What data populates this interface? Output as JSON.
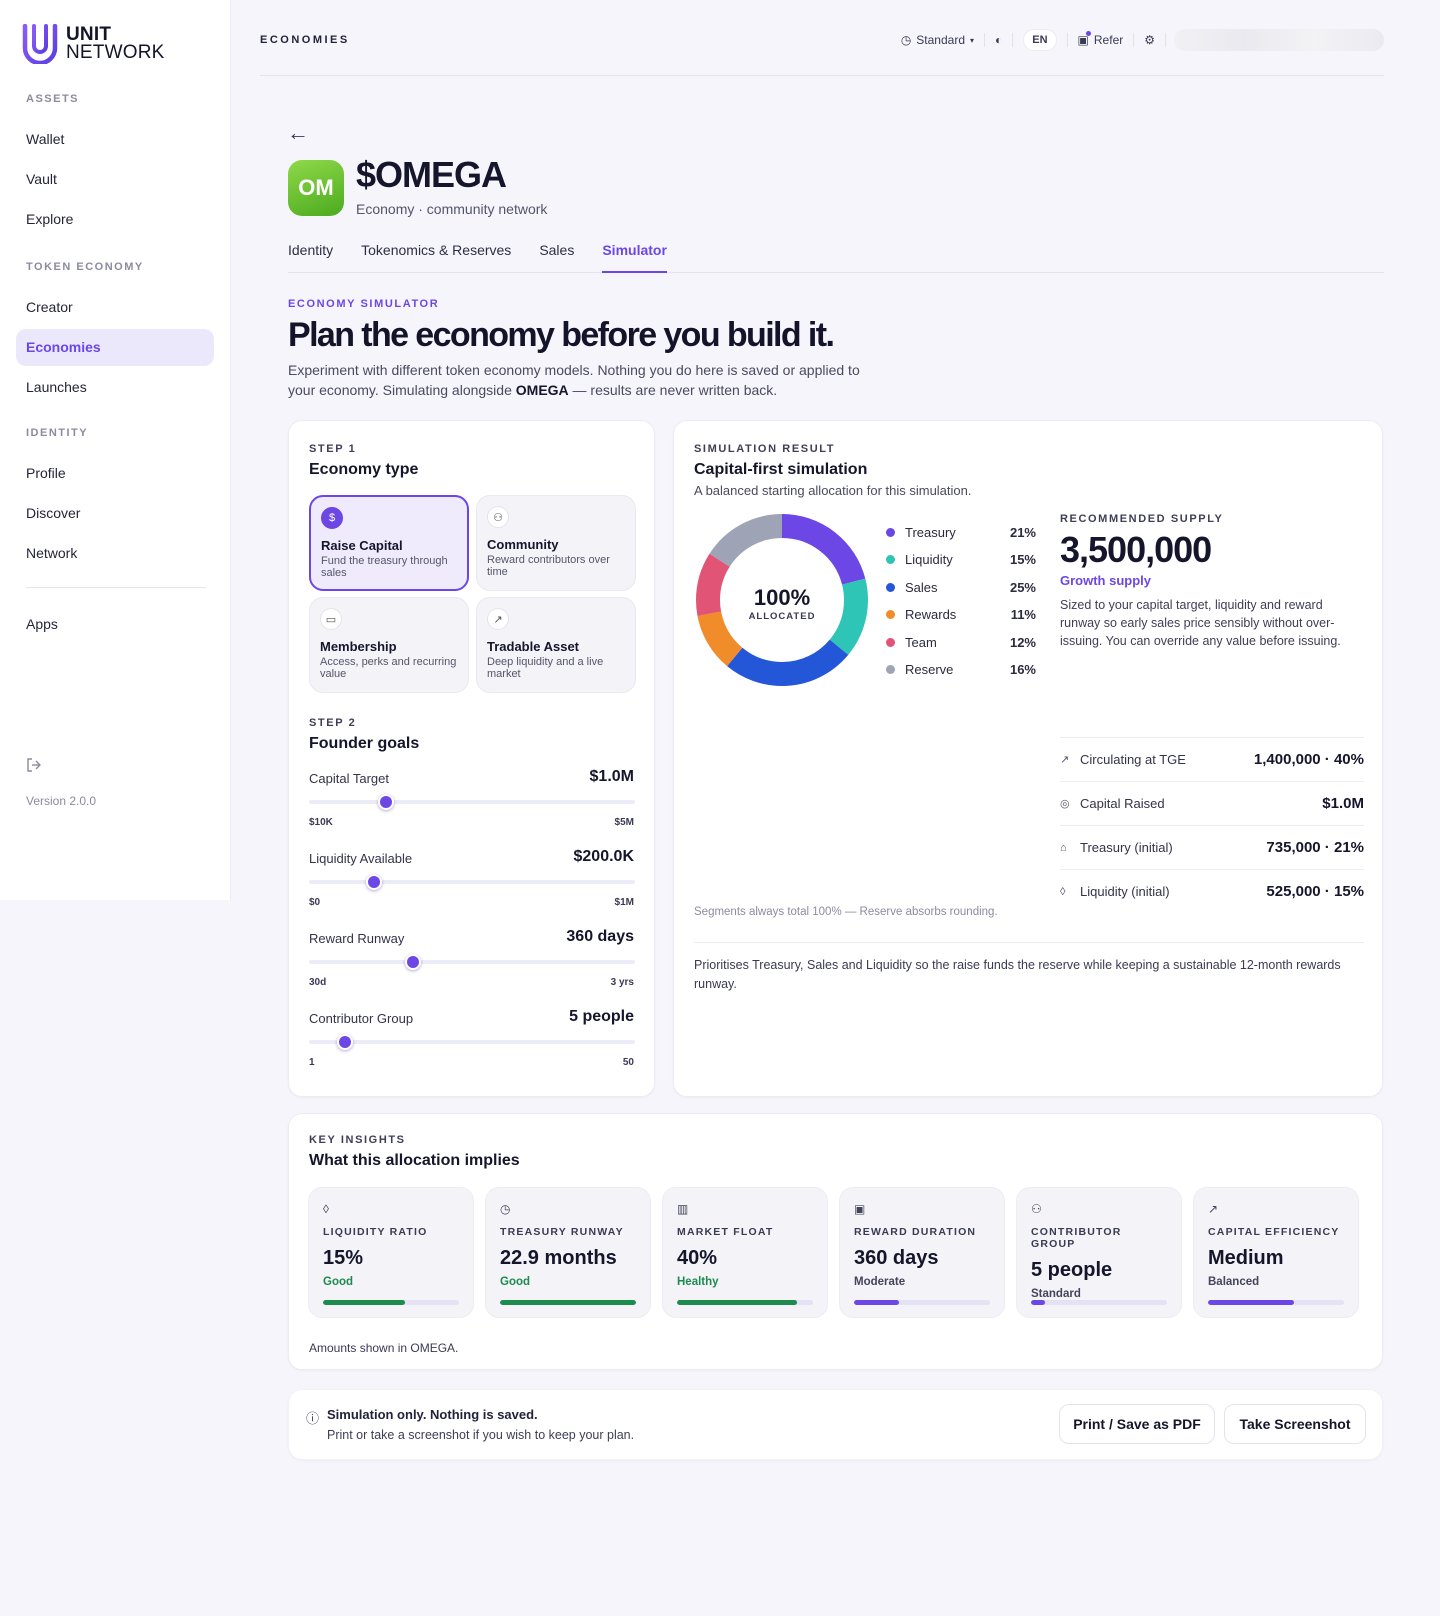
{
  "brand": {
    "line1": "UNIT",
    "line2": "NETWORK",
    "accent": "#6c47e6"
  },
  "sidebar": {
    "sections": [
      {
        "label": "ASSETS",
        "items": [
          "Wallet",
          "Vault",
          "Explore"
        ]
      },
      {
        "label": "TOKEN ECONOMY",
        "items": [
          "Creator",
          "Economies",
          "Launches"
        ]
      },
      {
        "label": "IDENTITY",
        "items": [
          "Profile",
          "Discover",
          "Network"
        ]
      }
    ],
    "active_item": "Economies",
    "apps": "Apps",
    "logout_icon": "logout-icon",
    "version": "Version 2.0.0"
  },
  "topbar": {
    "title": "ECONOMIES",
    "mode": "Standard",
    "lang": "EN",
    "refer": "Refer"
  },
  "page": {
    "back_icon": "arrow-left-icon",
    "avatar": "OM",
    "title": "$OMEGA",
    "subtitle": "Economy · community network",
    "tabs": [
      "Identity",
      "Tokenomics & Reserves",
      "Sales",
      "Simulator"
    ],
    "active_tab": "Simulator",
    "eyebrow": "ECONOMY SIMULATOR",
    "hero": "Plan the economy before you build it.",
    "desc_1": "Experiment with different token economy models. Nothing you do here is saved or applied to your economy. Simulating alongside ",
    "desc_bold": "OMEGA",
    "desc_2": " — results are never written back."
  },
  "step1": {
    "step": "STEP 1",
    "title": "Economy type",
    "types": [
      {
        "name": "Raise Capital",
        "desc": "Fund the treasury through sales",
        "icon": "dollar-icon",
        "glyph": "$",
        "selected": true
      },
      {
        "name": "Community",
        "desc": "Reward contributors over time",
        "icon": "users-icon",
        "glyph": "⚇",
        "selected": false
      },
      {
        "name": "Membership",
        "desc": "Access, perks and recurring value",
        "icon": "card-icon",
        "glyph": "▭",
        "selected": false
      },
      {
        "name": "Tradable Asset",
        "desc": "Deep liquidity and a live market",
        "icon": "trend-up-icon",
        "glyph": "↗",
        "selected": false
      }
    ]
  },
  "step2": {
    "step": "STEP 2",
    "title": "Founder goals",
    "goals": [
      {
        "label": "Capital Target",
        "value": "$1.0M",
        "min": "$10K",
        "max": "$5M",
        "fraction": 0.235
      },
      {
        "label": "Liquidity Available",
        "value": "$200.0K",
        "min": "$0",
        "max": "$1M",
        "fraction": 0.198
      },
      {
        "label": "Reward Runway",
        "value": "360 days",
        "min": "30d",
        "max": "3 yrs",
        "fraction": 0.318
      },
      {
        "label": "Contributor Group",
        "value": "5 people",
        "min": "1",
        "max": "50",
        "fraction": 0.11
      }
    ]
  },
  "result": {
    "eyebrow": "SIMULATION RESULT",
    "title": "Capital-first simulation",
    "subtitle": "A balanced starting allocation for this simulation.",
    "donut_center": "100%",
    "donut_center_label": "ALLOCATED",
    "allocation": [
      {
        "name": "Treasury",
        "pct": 21,
        "label": "21%",
        "color": "#6c47e6"
      },
      {
        "name": "Liquidity",
        "pct": 15,
        "label": "15%",
        "color": "#2ec4b6"
      },
      {
        "name": "Sales",
        "pct": 25,
        "label": "25%",
        "color": "#2456d8"
      },
      {
        "name": "Rewards",
        "pct": 11,
        "label": "11%",
        "color": "#f08c2a"
      },
      {
        "name": "Team",
        "pct": 12,
        "label": "12%",
        "color": "#e15475"
      },
      {
        "name": "Reserve",
        "pct": 16,
        "label": "16%",
        "color": "#9ea3b5"
      }
    ],
    "footnote": "Segments always total 100% — Reserve absorbs rounding.",
    "supply_label": "RECOMMENDED SUPPLY",
    "supply_value": "3,500,000",
    "supply_tag": "Growth supply",
    "supply_desc": "Sized to your capital target, liquidity and reward runway so early sales price sensibly without over-issuing. You can override any value before issuing.",
    "stats": [
      {
        "icon": "trend-up-icon",
        "glyph": "↗",
        "label": "Circulating at TGE",
        "value": "1,400,000 · 40%"
      },
      {
        "icon": "coins-icon",
        "glyph": "◎",
        "label": "Capital Raised",
        "value": "$1.0M"
      },
      {
        "icon": "bank-icon",
        "glyph": "⌂",
        "label": "Treasury (initial)",
        "value": "735,000 · 21%"
      },
      {
        "icon": "droplet-icon",
        "glyph": "◊",
        "label": "Liquidity (initial)",
        "value": "525,000 · 15%"
      }
    ],
    "summary": "Prioritises Treasury, Sales and Liquidity so the raise funds the reserve while keeping a sustainable 12-month rewards runway."
  },
  "insights": {
    "eyebrow": "KEY INSIGHTS",
    "title": "What this allocation implies",
    "items": [
      {
        "icon": "droplet-icon",
        "glyph": "◊",
        "label": "LIQUIDITY RATIO",
        "value": "15%",
        "status": "Good",
        "color": "#1d8a4e",
        "fill": 0.6
      },
      {
        "icon": "clock-icon",
        "glyph": "◷",
        "label": "TREASURY RUNWAY",
        "value": "22.9 months",
        "status": "Good",
        "color": "#1d8a4e",
        "fill": 1.0
      },
      {
        "icon": "bar-chart-icon",
        "glyph": "▥",
        "label": "MARKET FLOAT",
        "value": "40%",
        "status": "Healthy",
        "color": "#1d8a4e",
        "fill": 0.88
      },
      {
        "icon": "gift-icon",
        "glyph": "▣",
        "label": "REWARD DURATION",
        "value": "360 days",
        "status": "Moderate",
        "color": "#6c47e6",
        "statusColor": "#44445a",
        "fill": 0.33
      },
      {
        "icon": "user-icon",
        "glyph": "⚇",
        "label": "CONTRIBUTOR GROUP",
        "value": "5 people",
        "status": "Standard",
        "color": "#6c47e6",
        "statusColor": "#44445a",
        "fill": 0.1
      },
      {
        "icon": "trend-up-icon",
        "glyph": "↗",
        "label": "CAPITAL EFFICIENCY",
        "value": "Medium",
        "status": "Balanced",
        "color": "#6c47e6",
        "statusColor": "#44445a",
        "fill": 0.63
      }
    ],
    "footnote": "Amounts shown in OMEGA."
  },
  "footer": {
    "info_icon": "info-icon",
    "title": "Simulation only. Nothing is saved.",
    "desc": "Print or take a screenshot if you wish to keep your plan.",
    "print_btn": "Print / Save as PDF",
    "screenshot_btn": "Take Screenshot"
  }
}
